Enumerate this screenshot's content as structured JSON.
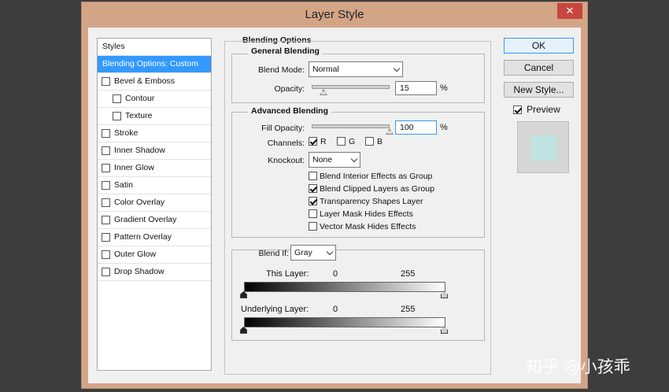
{
  "window": {
    "title": "Layer Style",
    "close_glyph": "✕"
  },
  "sidebar": {
    "header": "Styles",
    "items": [
      {
        "label": "Blending Options: Custom",
        "active": true,
        "checkbox": false,
        "indent": 0,
        "checked": false
      },
      {
        "label": "Bevel & Emboss",
        "active": false,
        "checkbox": true,
        "indent": 0,
        "checked": false
      },
      {
        "label": "Contour",
        "active": false,
        "checkbox": true,
        "indent": 1,
        "checked": false
      },
      {
        "label": "Texture",
        "active": false,
        "checkbox": true,
        "indent": 1,
        "checked": false
      },
      {
        "label": "Stroke",
        "active": false,
        "checkbox": true,
        "indent": 0,
        "checked": false
      },
      {
        "label": "Inner Shadow",
        "active": false,
        "checkbox": true,
        "indent": 0,
        "checked": false
      },
      {
        "label": "Inner Glow",
        "active": false,
        "checkbox": true,
        "indent": 0,
        "checked": false
      },
      {
        "label": "Satin",
        "active": false,
        "checkbox": true,
        "indent": 0,
        "checked": false
      },
      {
        "label": "Color Overlay",
        "active": false,
        "checkbox": true,
        "indent": 0,
        "checked": false
      },
      {
        "label": "Gradient Overlay",
        "active": false,
        "checkbox": true,
        "indent": 0,
        "checked": false
      },
      {
        "label": "Pattern Overlay",
        "active": false,
        "checkbox": true,
        "indent": 0,
        "checked": false
      },
      {
        "label": "Outer Glow",
        "active": false,
        "checkbox": true,
        "indent": 0,
        "checked": false
      },
      {
        "label": "Drop Shadow",
        "active": false,
        "checkbox": true,
        "indent": 0,
        "checked": false
      }
    ]
  },
  "blending": {
    "title": "Blending Options",
    "general": {
      "title": "General Blending",
      "blend_mode_label": "Blend Mode:",
      "blend_mode": "Normal",
      "opacity_label": "Opacity:",
      "opacity": "15",
      "opacity_fraction": 0.15,
      "unit": "%"
    },
    "advanced": {
      "title": "Advanced Blending",
      "fill_label": "Fill Opacity:",
      "fill": "100",
      "fill_fraction": 1.0,
      "unit": "%",
      "channels_label": "Channels:",
      "channels": [
        {
          "label": "R",
          "checked": true
        },
        {
          "label": "G",
          "checked": false
        },
        {
          "label": "B",
          "checked": false
        }
      ],
      "knockout_label": "Knockout:",
      "knockout": "None",
      "options": [
        {
          "label": "Blend Interior Effects as Group",
          "checked": false
        },
        {
          "label": "Blend Clipped Layers as Group",
          "checked": true
        },
        {
          "label": "Transparency Shapes Layer",
          "checked": true
        },
        {
          "label": "Layer Mask Hides Effects",
          "checked": false
        },
        {
          "label": "Vector Mask Hides Effects",
          "checked": false
        }
      ]
    },
    "blend_if": {
      "label": "Blend If:",
      "value": "Gray",
      "this_layer_label": "This Layer:",
      "underlying_label": "Underlying Layer:",
      "min": "0",
      "max": "255"
    }
  },
  "buttons": {
    "ok": "OK",
    "cancel": "Cancel",
    "new_style": "New Style..."
  },
  "preview": {
    "label": "Preview",
    "checked": true,
    "swatch_color": "#bfe3e3"
  },
  "watermark": "知乎 @小孩乖"
}
